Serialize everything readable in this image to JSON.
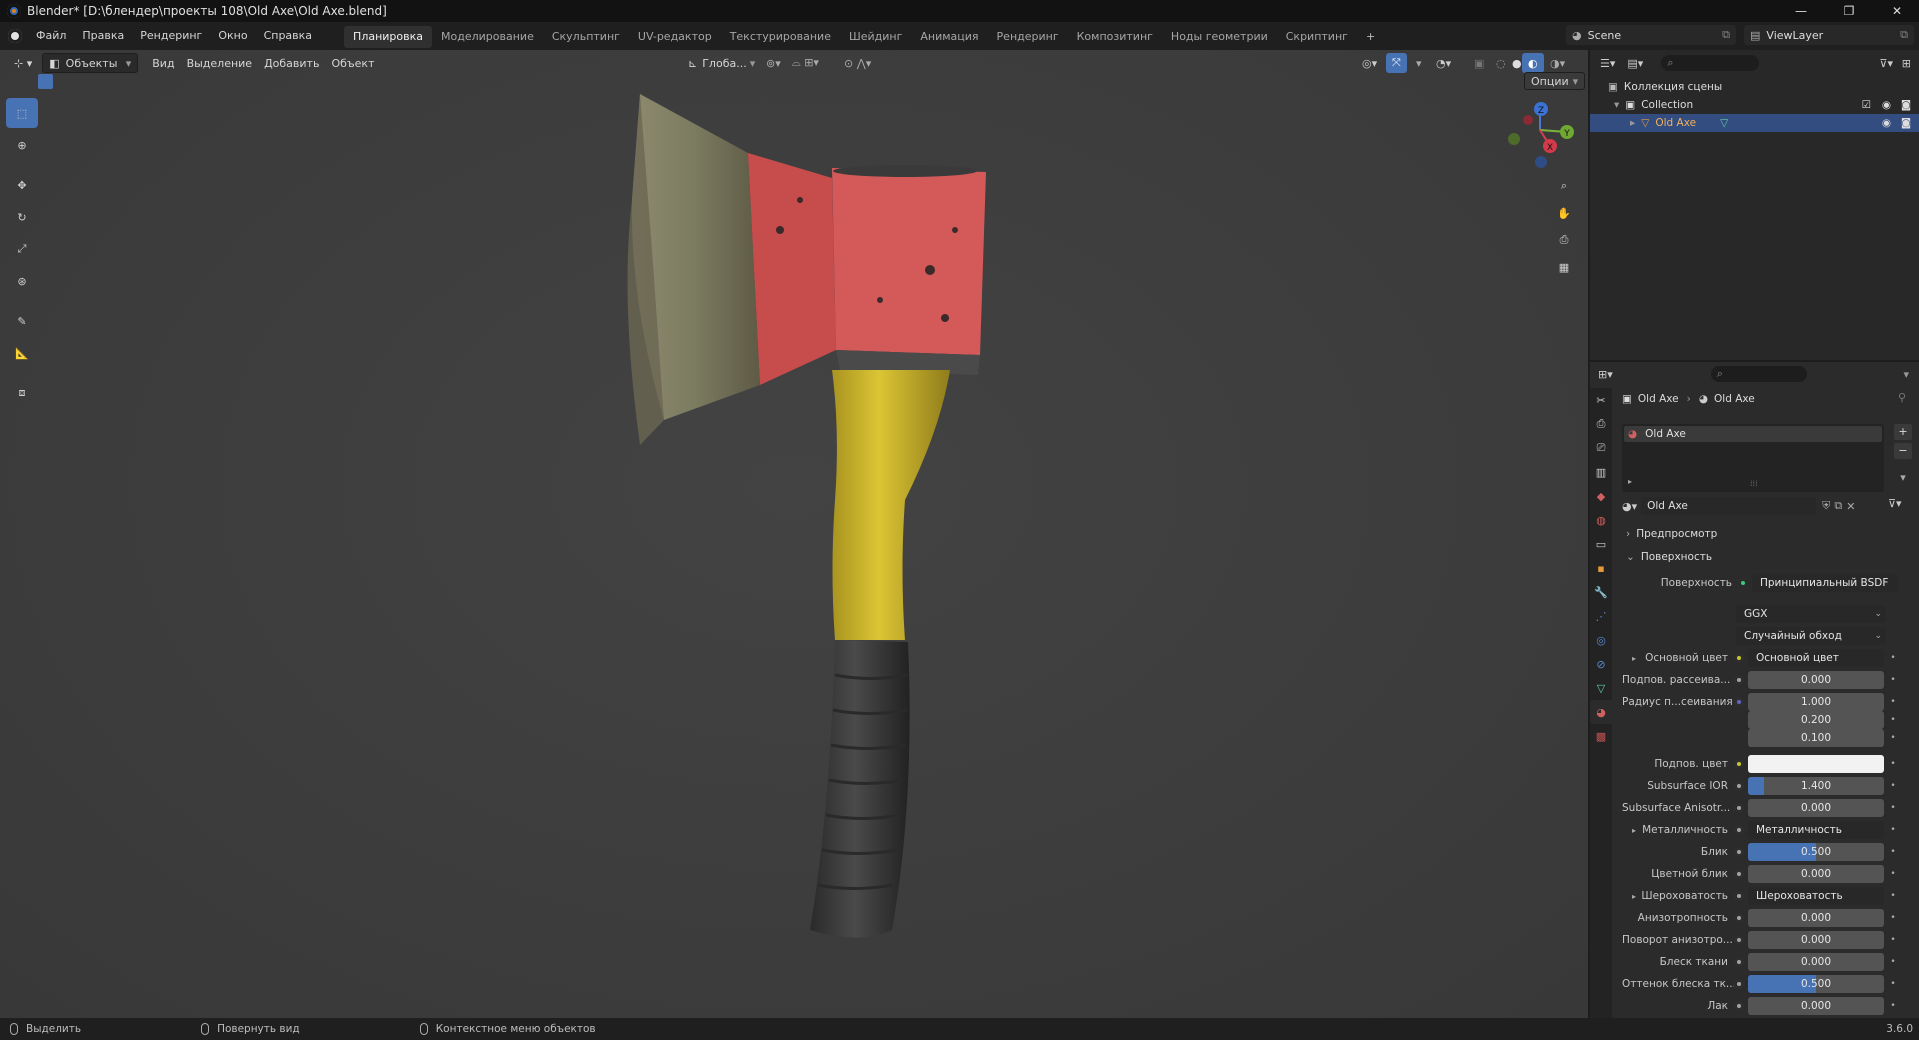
{
  "window": {
    "title": "Blender* [D:\\блендер\\проекты 108\\Old Axe\\Old Axe.blend]",
    "minimize": "—",
    "maximize": "❐",
    "close": "✕"
  },
  "menu": {
    "items": [
      "Файл",
      "Правка",
      "Рендеринг",
      "Окно",
      "Справка"
    ]
  },
  "workspaces": {
    "tabs": [
      "Планировка",
      "Моделирование",
      "Скульптинг",
      "UV-редактор",
      "Текстурирование",
      "Шейдинг",
      "Анимация",
      "Рендеринг",
      "Композитинг",
      "Ноды геометрии",
      "Скриптинг"
    ],
    "active_index": 0,
    "add": "+"
  },
  "scene": {
    "name": "Scene"
  },
  "view_layer": {
    "name": "ViewLayer"
  },
  "viewport_header": {
    "mode": "Объекты",
    "view": "Вид",
    "select": "Выделение",
    "add": "Добавить",
    "object": "Объект",
    "transform_orientation": "Глоба...",
    "options": "Опции"
  },
  "gizmo": {
    "z": "Z",
    "y": "Y",
    "x": "X"
  },
  "outliner": {
    "root": "Коллекция сцены",
    "collection": "Collection",
    "object": "Old Axe"
  },
  "properties": {
    "breadcrumb_object": "Old Axe",
    "breadcrumb_material": "Old Axe",
    "slot_name": "Old Axe",
    "material_name": "Old Axe",
    "section_preview": "Предпросмотр",
    "section_surface": "Поверхность",
    "surface_label": "Поверхность",
    "surface_value": "Принципиальный BSDF",
    "distribution": "GGX",
    "subsurface_method": "Случайный обход",
    "rows": [
      {
        "label": "Основной цвет",
        "value": "Основной цвет",
        "kind": "link",
        "dot": "#c7c729"
      },
      {
        "label": "Подпов. рассеива...",
        "value": "0.000",
        "kind": "num",
        "fill": 0
      },
      {
        "label": "Радиус п...сеивания",
        "value": "1.000",
        "kind": "num",
        "fill": 0,
        "dot": "#6363c7"
      },
      {
        "label": "",
        "value": "0.200",
        "kind": "num",
        "fill": 0,
        "nodot": true
      },
      {
        "label": "",
        "value": "0.100",
        "kind": "num",
        "fill": 0,
        "nodot": true
      },
      {
        "label": "Подпов. цвет",
        "value": "",
        "kind": "color",
        "color": "#f2f2f2",
        "dot": "#c7c729"
      },
      {
        "label": "Subsurface IOR",
        "value": "1.400",
        "kind": "num",
        "fill": 0.12
      },
      {
        "label": "Subsurface Anisotr...",
        "value": "0.000",
        "kind": "num",
        "fill": 0
      },
      {
        "label": "Металличность",
        "value": "Металличность",
        "kind": "link"
      },
      {
        "label": "Блик",
        "value": "0.500",
        "kind": "num",
        "fill": 0.5
      },
      {
        "label": "Цветной блик",
        "value": "0.000",
        "kind": "num",
        "fill": 0
      },
      {
        "label": "Шероховатость",
        "value": "Шероховатость",
        "kind": "link"
      },
      {
        "label": "Анизотропность",
        "value": "0.000",
        "kind": "num",
        "fill": 0
      },
      {
        "label": "Поворот анизотро...",
        "value": "0.000",
        "kind": "num",
        "fill": 0
      },
      {
        "label": "Блеск ткани",
        "value": "0.000",
        "kind": "num",
        "fill": 0
      },
      {
        "label": "Оттенок блеска тк...",
        "value": "0.500",
        "kind": "num",
        "fill": 0.5
      },
      {
        "label": "Лак",
        "value": "0.000",
        "kind": "num",
        "fill": 0
      }
    ]
  },
  "statusbar": {
    "select": "Выделить",
    "rotate": "Повернуть вид",
    "context": "Контекстное меню объектов",
    "version": "3.6.0"
  }
}
